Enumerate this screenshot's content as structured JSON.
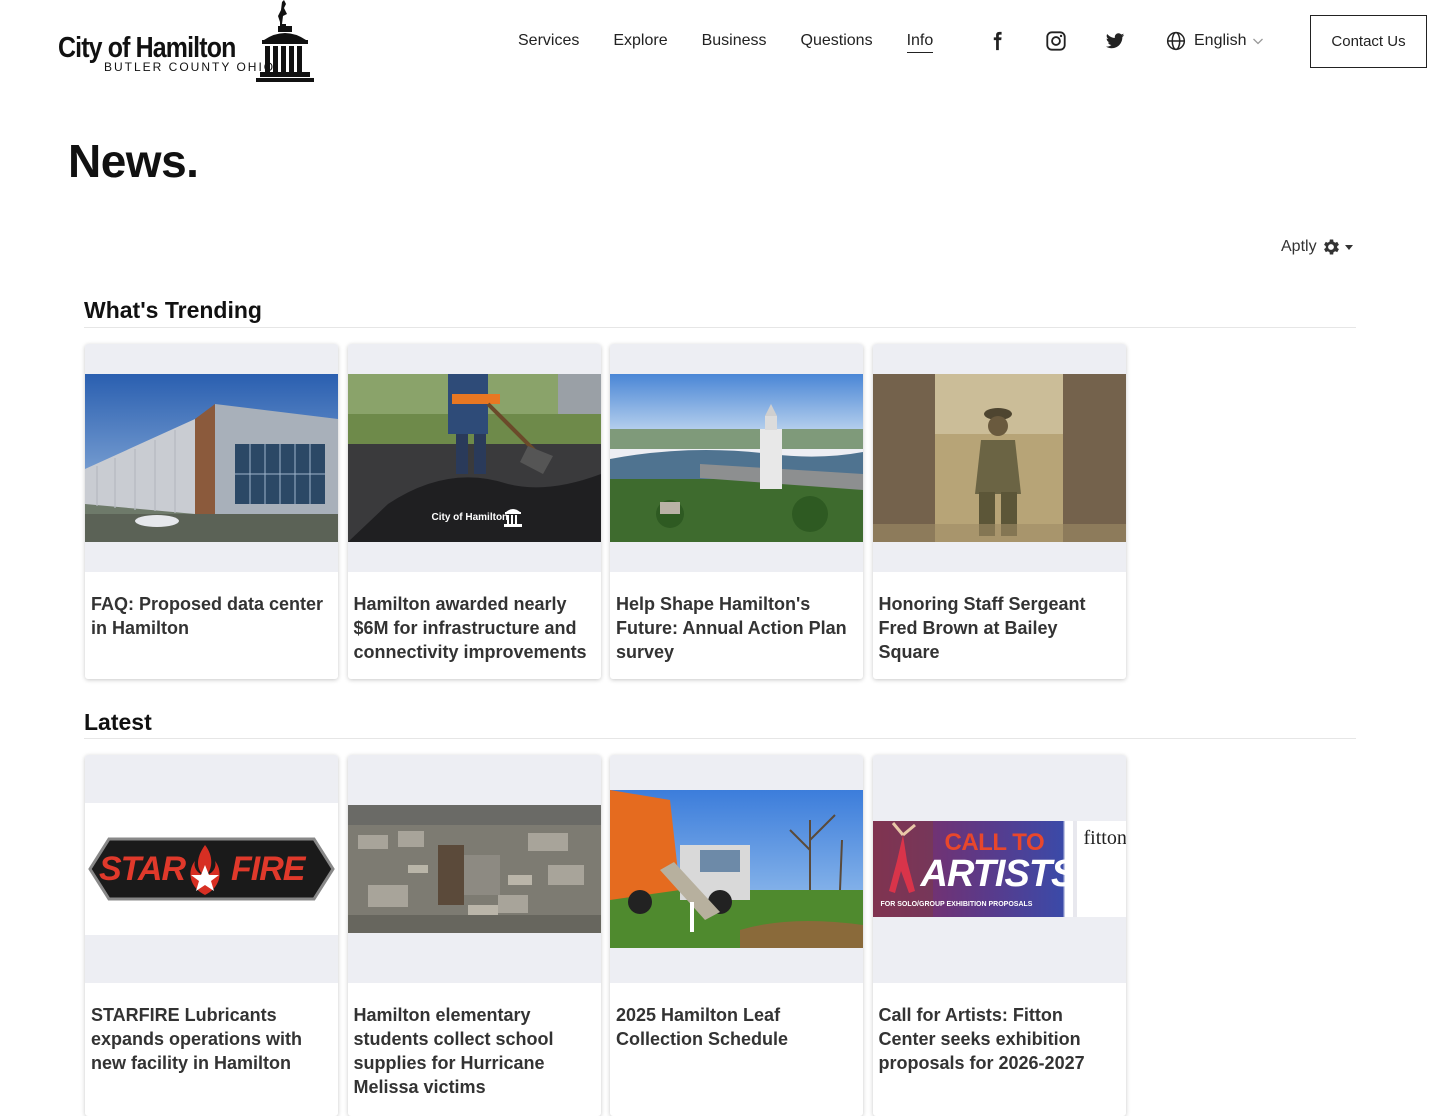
{
  "header": {
    "logo_title": "City of Hamilton",
    "logo_sub": "BUTLER COUNTY OHIO",
    "nav": [
      {
        "label": "Services"
      },
      {
        "label": "Explore"
      },
      {
        "label": "Business"
      },
      {
        "label": "Questions"
      },
      {
        "label": "Info",
        "active": true
      }
    ],
    "social": [
      "facebook-icon",
      "instagram-icon",
      "twitter-icon"
    ],
    "language": "English",
    "contact_label": "Contact Us"
  },
  "page_title": "News.",
  "aptly_label": "Aptly",
  "trending": {
    "title": "What's Trending",
    "cards": [
      {
        "title": "FAQ: Proposed data center in Hamilton",
        "image": "data-center-building"
      },
      {
        "title": "Hamilton awarded nearly $6M for infrastructure and connectivity improvements",
        "image": "asphalt-worker",
        "image_caption": "City of Hamilton"
      },
      {
        "title": "Help Shape Hamilton's Future: Annual Action Plan survey",
        "image": "aerial-river-city"
      },
      {
        "title": "Honoring Staff Sergeant Fred Brown at Bailey Square",
        "image": "soldier-portrait"
      }
    ]
  },
  "latest": {
    "title": "Latest",
    "cards": [
      {
        "title": "STARFIRE Lubricants expands operations with new facility in Hamilton",
        "image": "starfire-logo",
        "logo_left": "STAR",
        "logo_right": "FIRE"
      },
      {
        "title": "Hamilton elementary students collect school supplies for Hurricane Melissa victims",
        "image": "aerial-storm-damage"
      },
      {
        "title": "2025 Hamilton Leaf Collection Schedule",
        "image": "leaf-truck"
      },
      {
        "title": "Call for Artists: Fitton Center seeks exhibition proposals for 2026-2027",
        "image": "call-to-artists",
        "banner_line1": "CALL TO",
        "banner_line2": "ARTISTS",
        "banner_foot": "FOR SOLO/GROUP EXHIBITION PROPOSALS",
        "banner_brand": "fitton"
      }
    ]
  },
  "colors": {
    "card_bg": "#edeef3",
    "text": "#222222",
    "accent_orange": "#e8621e"
  }
}
